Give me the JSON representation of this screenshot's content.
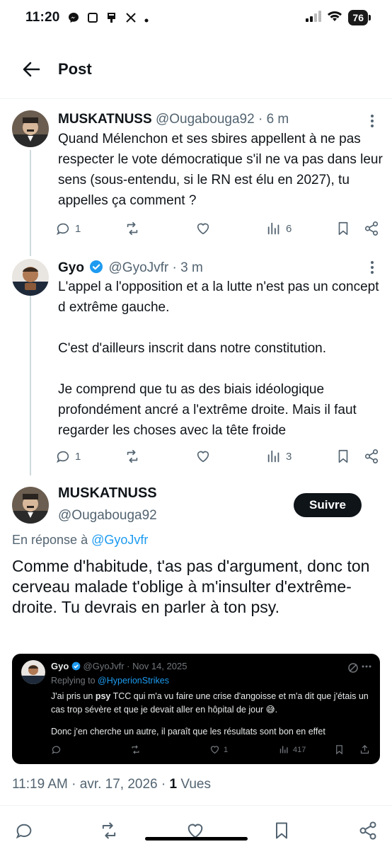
{
  "status_bar": {
    "time": "11:20",
    "left_icons": [
      "messenger-icon",
      "square-icon",
      "flag-icon",
      "x-logo-icon",
      "dot-icon"
    ],
    "battery": "76"
  },
  "header": {
    "title": "Post",
    "back_icon": "arrow-left-icon"
  },
  "thread": [
    {
      "name": "MUSKATNUSS",
      "handle": "@Ougabouga92",
      "time": "6 m",
      "verified": false,
      "text": "Quand Mélenchon et ses sbires appellent à ne pas respecter le vote démocratique s'il ne va pas dans leur sens (sous-entendu, si le RN est élu en 2027), tu appelles ça comment ?",
      "replies": "1",
      "retweets": "",
      "likes": "",
      "views": "6"
    },
    {
      "name": "Gyo",
      "handle": "@GyoJvfr",
      "time": "3 m",
      "verified": true,
      "text_paragraphs": [
        "L'appel a l'opposition et a la lutte n'est pas un concept d extrême gauche.",
        "C'est d'ailleurs inscrit dans notre constitution.",
        "Je comprend que tu as des biais idéologique profondément ancré a l'extrême droite. Mais il faut regarder les choses avec la tête froide"
      ],
      "replies": "1",
      "retweets": "",
      "likes": "",
      "views": "3"
    }
  ],
  "main_tweet": {
    "name": "MUSKATNUSS",
    "handle": "@Ougabouga92",
    "follow_label": "Suivre",
    "reply_prefix": "En réponse à",
    "reply_to": "@GyoJvfr",
    "text": "Comme d'habitude, t'as pas d'argument, donc ton cerveau malade t'oblige à m'insulter d'extrême-droite. Tu devrais en parler à ton psy.",
    "timestamp": "11:19 AM · avr. 17, 2026 · ",
    "view_count": "1",
    "view_label": " Vues"
  },
  "embedded": {
    "name": "Gyo",
    "handle": "@GyoJvfr",
    "date": "Nov 14, 2025",
    "replying_prefix": "Replying to",
    "replying_to": "@HyperionStrikes",
    "line1_a": "J'ai pris un ",
    "line1_bold": "psy",
    "line1_b": " TCC qui m'a vu faire une crise d'angoisse et m'a dit que j'étais un cas trop sévère et que je devait aller en hôpital de jour 😅.",
    "line2": "Donc j'en cherche un autre, il paraît que les résultats sont bon en effet",
    "replies": "",
    "retweets": "",
    "likes": "1",
    "views": "417"
  },
  "colors": {
    "accent": "#1d9bf0",
    "text": "#0f1419",
    "muted": "#536471",
    "card_bg": "#000000"
  }
}
